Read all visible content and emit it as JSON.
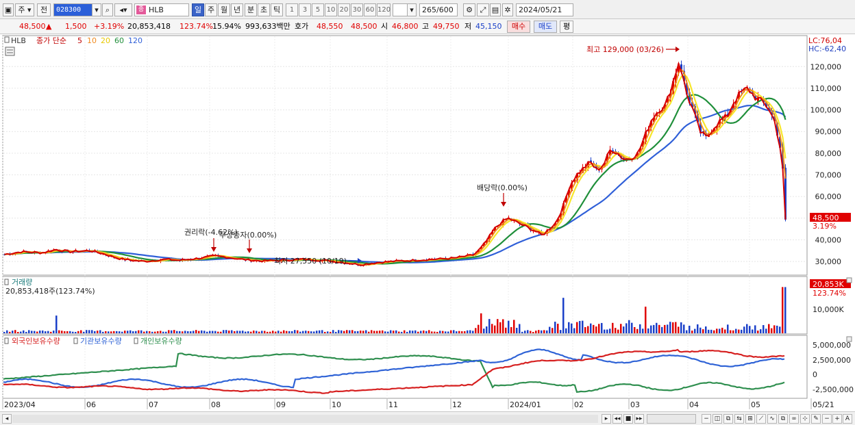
{
  "toolbar": {
    "period_type": "주",
    "period_mode": "전",
    "stock_code": "028300",
    "stock_name": "HLB",
    "stock_tag": "종",
    "timeframes": [
      "일",
      "주",
      "월",
      "년",
      "분",
      "초",
      "틱"
    ],
    "selected_timeframe": "일",
    "intervals": [
      "1",
      "3",
      "5",
      "10",
      "20",
      "30",
      "60",
      "120"
    ],
    "range_value": "265",
    "range_total": "/600",
    "date": "2024/05/21"
  },
  "quote": {
    "price": "48,500",
    "change": "1,500",
    "change_pct": "+3.19%",
    "volume": "20,853,418",
    "volume_ratio": "123.74%",
    "turnover": "15.94%",
    "amount": "993,633백만",
    "ask_label": "호가",
    "ask1": "48,550",
    "ask2": "48,500",
    "open_label": "시",
    "open": "46,800",
    "high_label": "고",
    "high": "49,750",
    "low_label": "저",
    "low": "45,150",
    "buy_label": "매수",
    "sell_label": "매도",
    "avg_label": "평"
  },
  "price_panel": {
    "legend_name": "HLB",
    "legend_ma": "종가 단순",
    "ma_periods": [
      "5",
      "10",
      "20",
      "60",
      "120"
    ],
    "lc": "LC:76,04",
    "hc": "HC:-62,40",
    "current_price": "48,500",
    "current_pct": "3.19%",
    "annotations": {
      "high": "최고 129,000 (03/26)",
      "low": "최저 27,550 (10/19)",
      "dividend": "배당락(0.00%)",
      "rights": "권리락(-4.62%)",
      "bonus": "무상증자(0.00%)"
    }
  },
  "volume_panel": {
    "title": "거래량",
    "value": "20,853,418주(123.74%)",
    "badge_value": "20,853K",
    "badge_pct": "123.74%",
    "axis_label": "10,000K"
  },
  "holdings_panel": {
    "legend": [
      "외국인보유수량",
      "기관보유수량",
      "개인보유수량"
    ],
    "axis_labels": [
      "5,000,000",
      "2,500,000",
      "0",
      "-2,500,000"
    ]
  },
  "x_axis": {
    "labels": [
      "2023/04",
      "06",
      "07",
      "08",
      "09",
      "10",
      "11",
      "12",
      "2024/01",
      "02",
      "03",
      "04",
      "05",
      "05/21"
    ]
  },
  "chart_data": {
    "type": "line",
    "price_axis": [
      "120,000",
      "110,000",
      "100,000",
      "90,000",
      "80,000",
      "70,000",
      "60,000",
      "50,000",
      "40,000",
      "30,000"
    ],
    "price_ylim": [
      24000,
      134000
    ],
    "price_series": {
      "name": "HLB",
      "points": [
        [
          0,
          33000
        ],
        [
          30,
          34500
        ],
        [
          60,
          34000
        ],
        [
          80,
          35500
        ],
        [
          100,
          34500
        ],
        [
          130,
          35000
        ],
        [
          150,
          33500
        ],
        [
          170,
          31500
        ],
        [
          190,
          30500
        ],
        [
          210,
          30000
        ],
        [
          240,
          31000
        ],
        [
          260,
          30500
        ],
        [
          290,
          31500
        ],
        [
          310,
          32500
        ],
        [
          330,
          32000
        ],
        [
          350,
          31000
        ],
        [
          380,
          30200
        ],
        [
          410,
          30500
        ],
        [
          440,
          31000
        ],
        [
          470,
          30500
        ],
        [
          500,
          29500
        ],
        [
          525,
          28500
        ],
        [
          550,
          29500
        ],
        [
          570,
          30000
        ],
        [
          600,
          30500
        ],
        [
          630,
          31000
        ],
        [
          660,
          31500
        ],
        [
          690,
          33000
        ],
        [
          700,
          36000
        ],
        [
          710,
          40000
        ],
        [
          720,
          45000
        ],
        [
          730,
          48000
        ],
        [
          740,
          50000
        ],
        [
          760,
          47000
        ],
        [
          780,
          44000
        ],
        [
          790,
          42000
        ],
        [
          800,
          45000
        ],
        [
          810,
          48000
        ],
        [
          820,
          55000
        ],
        [
          830,
          65000
        ],
        [
          840,
          70000
        ],
        [
          850,
          73000
        ],
        [
          860,
          76000
        ],
        [
          870,
          72000
        ],
        [
          880,
          75000
        ],
        [
          890,
          82000
        ],
        [
          900,
          80000
        ],
        [
          910,
          77000
        ],
        [
          920,
          78000
        ],
        [
          930,
          80000
        ],
        [
          940,
          88000
        ],
        [
          950,
          96000
        ],
        [
          960,
          100000
        ],
        [
          970,
          102000
        ],
        [
          980,
          112000
        ],
        [
          990,
          123000
        ],
        [
          1000,
          108000
        ],
        [
          1010,
          100000
        ],
        [
          1020,
          90000
        ],
        [
          1030,
          87000
        ],
        [
          1040,
          92000
        ],
        [
          1050,
          95000
        ],
        [
          1060,
          97000
        ],
        [
          1070,
          104000
        ],
        [
          1080,
          108000
        ],
        [
          1090,
          110000
        ],
        [
          1100,
          106000
        ],
        [
          1110,
          104000
        ],
        [
          1120,
          101000
        ],
        [
          1130,
          94000
        ],
        [
          1140,
          78000
        ],
        [
          1145,
          49000
        ]
      ]
    },
    "volume_ylim": [
      0,
      25000000
    ],
    "holdings_ylim": [
      -3800000,
      6800000
    ]
  },
  "colors": {
    "candle_up": "#e00000",
    "candle_down": "#1a3fc8",
    "ma5": "#d40000",
    "ma10": "#f08a1e",
    "ma20": "#f7e62a",
    "ma60": "#1f8f3a",
    "ma120": "#2f5fd8",
    "foreign": "#d62020",
    "institution": "#2f63d6",
    "individual": "#2f8f4f"
  }
}
